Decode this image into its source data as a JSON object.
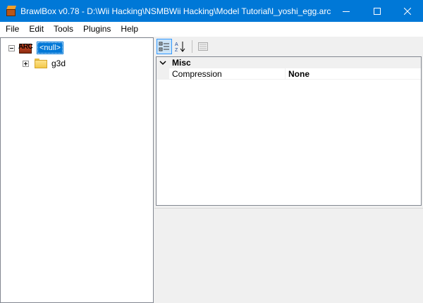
{
  "window": {
    "title": "BrawlBox v0.78 - D:\\Wii Hacking\\NSMBWii Hacking\\Model Tutorial\\l_yoshi_egg.arc",
    "accent": "#0078d7"
  },
  "menu": [
    "File",
    "Edit",
    "Tools",
    "Plugins",
    "Help"
  ],
  "tree": {
    "root": {
      "icon_text": "ARC",
      "label": "<null>",
      "expanded": true
    },
    "children": [
      {
        "label": "g3d",
        "expanded": false
      }
    ]
  },
  "toolbar": {
    "categorized_icon": "categorized-icon",
    "alphabetical_icon": "alphabetical-icon",
    "property_pages_icon": "property-pages-icon"
  },
  "properties": {
    "category": "Misc",
    "rows": [
      {
        "name": "Compression",
        "value": "None"
      }
    ]
  }
}
